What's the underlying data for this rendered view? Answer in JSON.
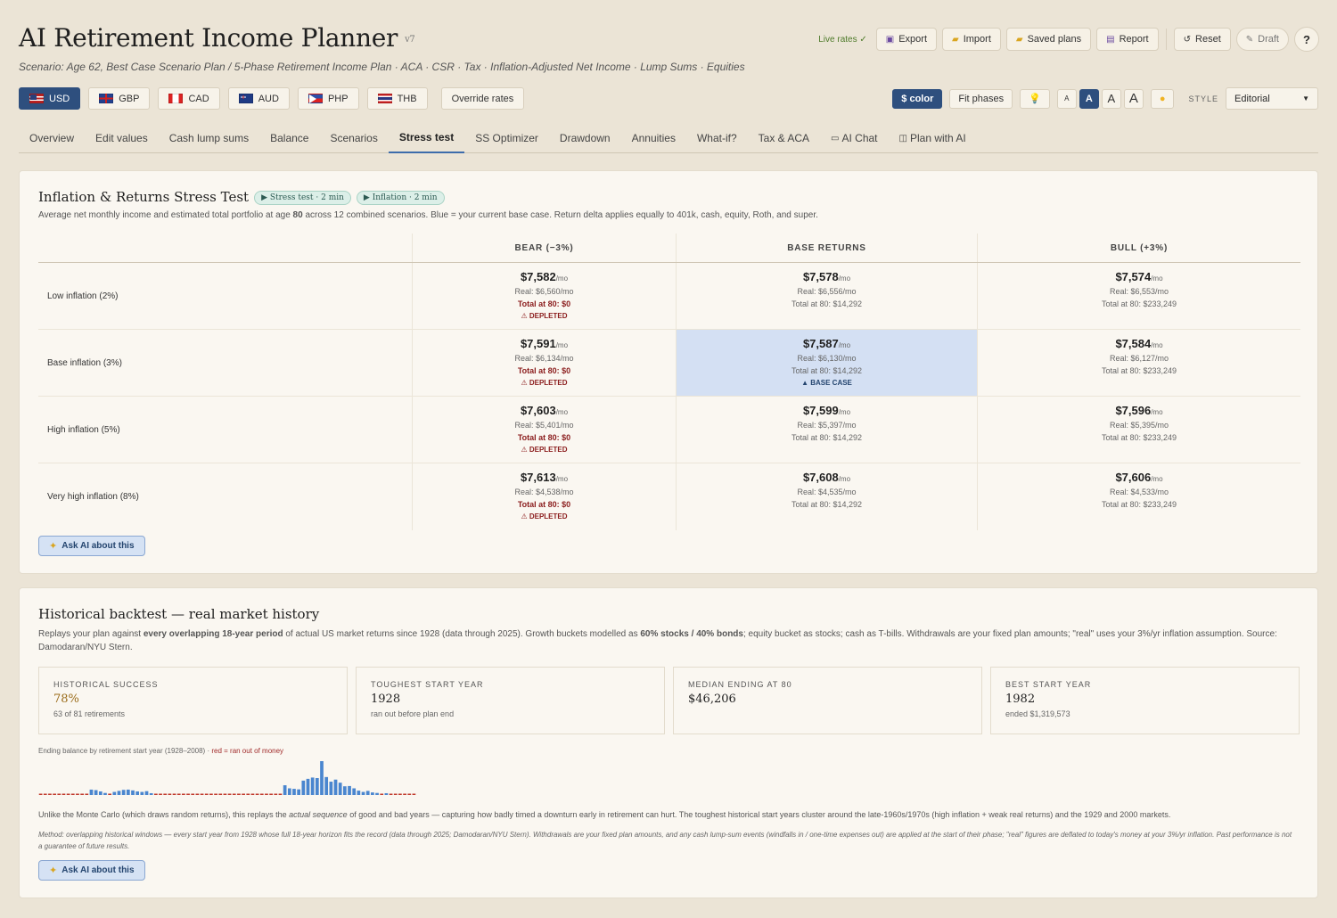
{
  "app": {
    "title": "AI Retirement Income Planner",
    "version": "v7",
    "scenario": "Scenario: Age 62, Best Case Scenario Plan / 5-Phase Retirement Income Plan · ACA · CSR · Tax · Inflation-Adjusted Net Income · Lump Sums · Equities"
  },
  "top_actions": {
    "live_rates": "Live rates ✓",
    "export": "Export",
    "import": "Import",
    "saved_plans": "Saved plans",
    "report": "Report",
    "reset": "Reset",
    "draft": "Draft",
    "help": "?"
  },
  "currencies": [
    {
      "code": "USD",
      "active": true
    },
    {
      "code": "GBP"
    },
    {
      "code": "CAD"
    },
    {
      "code": "AUD"
    },
    {
      "code": "PHP"
    },
    {
      "code": "THB"
    }
  ],
  "override_rates": "Override rates",
  "tools": {
    "color": "$ color",
    "fit_phases": "Fit phases",
    "hint_icon": "lightbulb-icon",
    "sizes": [
      "A",
      "A",
      "A",
      "A"
    ],
    "theme_icon": "sun-icon",
    "style_label": "STYLE",
    "style_value": "Editorial"
  },
  "tabs": [
    "Overview",
    "Edit values",
    "Cash lump sums",
    "Balance",
    "Scenarios",
    "Stress test",
    "SS Optimizer",
    "Drawdown",
    "Annuities",
    "What-if?",
    "Tax & ACA",
    "AI Chat",
    "Plan with AI"
  ],
  "active_tab": "Stress test",
  "stress": {
    "title": "Inflation & Returns Stress Test",
    "chip1": "▶ Stress test · 2 min",
    "chip2": "▶ Inflation · 2 min",
    "desc_prefix": "Average net monthly income and estimated total portfolio at age",
    "desc_age": "80",
    "desc_suffix": "across 12 combined scenarios. Blue = your current base case. Return delta applies equally to 401k, cash, equity, Roth, and super.",
    "columns": [
      "BEAR (−3%)",
      "BASE RETURNS",
      "BULL (+3%)"
    ],
    "rows": [
      {
        "label": "Low inflation (2%)",
        "cells": [
          {
            "nominal": "$7,582",
            "unit": "/mo",
            "real": "Real: $6,560/mo",
            "total": "Total at 80: $0",
            "flag": "⚠ DEPLETED"
          },
          {
            "nominal": "$7,578",
            "unit": "/mo",
            "real": "Real: $6,556/mo",
            "total": "Total at 80: $14,292",
            "flag": ""
          },
          {
            "nominal": "$7,574",
            "unit": "/mo",
            "real": "Real: $6,553/mo",
            "total": "Total at 80: $233,249",
            "flag": ""
          }
        ]
      },
      {
        "label": "Base inflation (3%)",
        "cells": [
          {
            "nominal": "$7,591",
            "unit": "/mo",
            "real": "Real: $6,134/mo",
            "total": "Total at 80: $0",
            "flag": "⚠ DEPLETED"
          },
          {
            "nominal": "$7,587",
            "unit": "/mo",
            "real": "Real: $6,130/mo",
            "total": "Total at 80: $14,292",
            "flag": "▲ BASE CASE"
          },
          {
            "nominal": "$7,584",
            "unit": "/mo",
            "real": "Real: $6,127/mo",
            "total": "Total at 80: $233,249",
            "flag": ""
          }
        ]
      },
      {
        "label": "High inflation (5%)",
        "cells": [
          {
            "nominal": "$7,603",
            "unit": "/mo",
            "real": "Real: $5,401/mo",
            "total": "Total at 80: $0",
            "flag": "⚠ DEPLETED"
          },
          {
            "nominal": "$7,599",
            "unit": "/mo",
            "real": "Real: $5,397/mo",
            "total": "Total at 80: $14,292",
            "flag": ""
          },
          {
            "nominal": "$7,596",
            "unit": "/mo",
            "real": "Real: $5,395/mo",
            "total": "Total at 80: $233,249",
            "flag": ""
          }
        ]
      },
      {
        "label": "Very high inflation (8%)",
        "cells": [
          {
            "nominal": "$7,613",
            "unit": "/mo",
            "real": "Real: $4,538/mo",
            "total": "Total at 80: $0",
            "flag": "⚠ DEPLETED"
          },
          {
            "nominal": "$7,608",
            "unit": "/mo",
            "real": "Real: $4,535/mo",
            "total": "Total at 80: $14,292",
            "flag": ""
          },
          {
            "nominal": "$7,606",
            "unit": "/mo",
            "real": "Real: $4,533/mo",
            "total": "Total at 80: $233,249",
            "flag": ""
          }
        ]
      }
    ],
    "ask_ai": "Ask AI about this"
  },
  "backtest": {
    "title": "Historical backtest — real market history",
    "desc_1": "Replays your plan against",
    "desc_bold1": "every overlapping 18-year period",
    "desc_2": "of actual US market returns since 1928 (data through 2025). Growth buckets modelled as",
    "desc_bold2": "60% stocks / 40% bonds",
    "desc_3": "; equity bucket as stocks; cash as T-bills. Withdrawals are your fixed plan amounts; \"real\" uses your 3%/yr inflation assumption. Source: Damodaran/NYU Stern.",
    "stats": [
      {
        "label": "HISTORICAL SUCCESS",
        "value": "78%",
        "sub": "63 of 81 retirements"
      },
      {
        "label": "TOUGHEST START YEAR",
        "value": "1928",
        "sub": "ran out before plan end"
      },
      {
        "label": "MEDIAN ENDING AT 80",
        "value": "$46,206",
        "sub": ""
      },
      {
        "label": "BEST START YEAR",
        "value": "1982",
        "sub": "ended $1,319,573"
      }
    ],
    "hist_label": "Ending balance by retirement start year (1928–2008) ·",
    "hist_red": "red = ran out of money",
    "note_1": "Unlike the Monte Carlo (which draws random returns), this replays the",
    "note_em": "actual sequence",
    "note_2": "of good and bad years — capturing how badly timed a downturn early in retirement can hurt. The toughest historical start years cluster around the late-1960s/1970s (high inflation + weak real returns) and the 1929 and 2000 markets.",
    "method": "Method: overlapping historical windows — every start year from 1928 whose full 18-year horizon fits the record (data through 2025; Damodaran/NYU Stern). Withdrawals are your fixed plan amounts, and any cash lump-sum events (windfalls in / one-time expenses out) are applied at the start of their phase; \"real\" figures are deflated to today's money at your 3%/yr inflation. Past performance is not a guarantee of future results.",
    "ask_ai": "Ask AI about this"
  },
  "chart_data": {
    "type": "bar",
    "x": [
      1928,
      1929,
      1930,
      1931,
      1932,
      1933,
      1934,
      1935,
      1936,
      1937,
      1938,
      1939,
      1940,
      1941,
      1942,
      1943,
      1944,
      1945,
      1946,
      1947,
      1948,
      1949,
      1950,
      1951,
      1952,
      1953,
      1954,
      1955,
      1956,
      1957,
      1958,
      1959,
      1960,
      1961,
      1962,
      1963,
      1964,
      1965,
      1966,
      1967,
      1968,
      1969,
      1970,
      1971,
      1972,
      1973,
      1974,
      1975,
      1976,
      1977,
      1978,
      1979,
      1980,
      1981,
      1982,
      1983,
      1984,
      1985,
      1986,
      1987,
      1988,
      1989,
      1990,
      1991,
      1992,
      1993,
      1994,
      1995,
      1996,
      1997,
      1998,
      1999,
      2000,
      2001,
      2002,
      2003,
      2004,
      2005,
      2006,
      2007,
      2008
    ],
    "values": [
      0,
      0,
      0,
      0,
      0,
      0,
      0,
      0,
      0,
      0,
      0,
      210000,
      190000,
      140000,
      80000,
      0,
      120000,
      160000,
      200000,
      210000,
      180000,
      140000,
      120000,
      150000,
      70000,
      0,
      0,
      0,
      0,
      0,
      0,
      0,
      0,
      0,
      0,
      0,
      0,
      0,
      0,
      0,
      0,
      0,
      0,
      0,
      0,
      0,
      0,
      0,
      0,
      0,
      0,
      0,
      0,
      380000,
      260000,
      240000,
      220000,
      560000,
      630000,
      680000,
      660000,
      1319573,
      700000,
      520000,
      600000,
      480000,
      340000,
      350000,
      260000,
      170000,
      120000,
      160000,
      100000,
      80000,
      0,
      70000,
      0,
      0,
      0,
      0,
      0,
      0
    ],
    "red_rule": "value 0 = ran out of money",
    "colors": {
      "ok": "#4a86cf",
      "depleted": "#c0392b"
    }
  }
}
